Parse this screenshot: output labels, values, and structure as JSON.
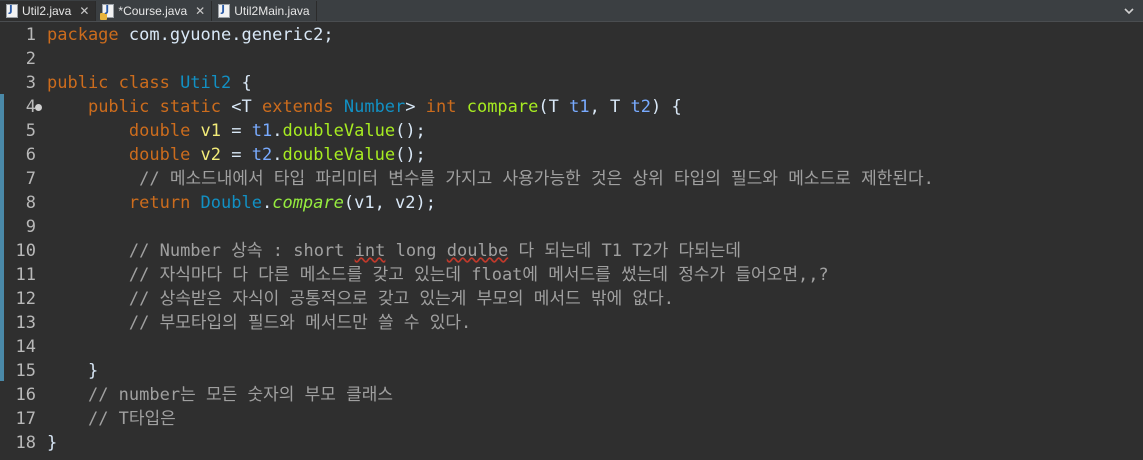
{
  "tabs": [
    {
      "label": "Util2.java",
      "active": true,
      "closable": true,
      "icon": "java-file-icon"
    },
    {
      "label": "*Course.java",
      "active": false,
      "closable": true,
      "icon": "java-file-warning-icon"
    },
    {
      "label": "Util2Main.java",
      "active": false,
      "closable": false,
      "icon": "java-file-icon"
    }
  ],
  "editor": {
    "lines": [
      {
        "n": "1",
        "tokens": [
          [
            "kw",
            "package"
          ],
          [
            "t",
            " com.gyuone.generic2;"
          ]
        ]
      },
      {
        "n": "2",
        "tokens": []
      },
      {
        "n": "3",
        "tokens": [
          [
            "kw",
            "public class "
          ],
          [
            "type",
            "Util2"
          ],
          [
            "t",
            " {"
          ]
        ]
      },
      {
        "n": "4",
        "fold": true,
        "tokens": [
          [
            "t",
            "    "
          ],
          [
            "kw",
            "public static "
          ],
          [
            "t",
            "<T "
          ],
          [
            "kw",
            "extends "
          ],
          [
            "type",
            "Number"
          ],
          [
            "t",
            "> "
          ],
          [
            "kw",
            "int "
          ],
          [
            "meth",
            "compare"
          ],
          [
            "t",
            "(T "
          ],
          [
            "param",
            "t1"
          ],
          [
            "t",
            ", T "
          ],
          [
            "param",
            "t2"
          ],
          [
            "t",
            ") {"
          ]
        ]
      },
      {
        "n": "5",
        "tokens": [
          [
            "t",
            "        "
          ],
          [
            "kw",
            "double "
          ],
          [
            "var",
            "v1"
          ],
          [
            "t",
            " = "
          ],
          [
            "param",
            "t1"
          ],
          [
            "t",
            "."
          ],
          [
            "meth",
            "doubleValue"
          ],
          [
            "t",
            "();"
          ]
        ]
      },
      {
        "n": "6",
        "tokens": [
          [
            "t",
            "        "
          ],
          [
            "kw",
            "double "
          ],
          [
            "var",
            "v2"
          ],
          [
            "t",
            " = "
          ],
          [
            "param",
            "t2"
          ],
          [
            "t",
            "."
          ],
          [
            "meth",
            "doubleValue"
          ],
          [
            "t",
            "();"
          ]
        ]
      },
      {
        "n": "7",
        "tokens": [
          [
            "t",
            "         "
          ],
          [
            "cm",
            "// 메소드내에서 타입 파리미터 변수를 가지고 사용가능한 것은 상위 타입의 필드와 메소드로 제한된다."
          ]
        ]
      },
      {
        "n": "8",
        "tokens": [
          [
            "t",
            "        "
          ],
          [
            "kw",
            "return "
          ],
          [
            "type",
            "Double"
          ],
          [
            "t",
            "."
          ],
          [
            "smeth",
            "compare"
          ],
          [
            "t",
            "(v1, v2);"
          ]
        ]
      },
      {
        "n": "9",
        "tokens": []
      },
      {
        "n": "10",
        "tokens": [
          [
            "t",
            "        "
          ],
          [
            "cm",
            "// Number 상속 : short "
          ],
          [
            "cmul",
            "int"
          ],
          [
            "cm",
            " long "
          ],
          [
            "cmul",
            "doulbe"
          ],
          [
            "cm",
            " 다 되는데 T1 T2가 다되는데"
          ]
        ]
      },
      {
        "n": "11",
        "tokens": [
          [
            "t",
            "        "
          ],
          [
            "cm",
            "// 자식마다 다 다른 메소드를 갖고 있는데 float에 메서드를 썼는데 정수가 들어오면,,?"
          ]
        ]
      },
      {
        "n": "12",
        "tokens": [
          [
            "t",
            "        "
          ],
          [
            "cm",
            "// 상속받은 자식이 공통적으로 갖고 있는게 부모의 메서드 밖에 없다."
          ]
        ]
      },
      {
        "n": "13",
        "tokens": [
          [
            "t",
            "        "
          ],
          [
            "cm",
            "// 부모타입의 필드와 메서드만 쓸 수 있다."
          ]
        ]
      },
      {
        "n": "14",
        "tokens": []
      },
      {
        "n": "15",
        "tokens": [
          [
            "t",
            "    }"
          ]
        ]
      },
      {
        "n": "16",
        "tokens": [
          [
            "t",
            "    "
          ],
          [
            "cm",
            "// number는 모든 숫자의 부모 클래스"
          ]
        ]
      },
      {
        "n": "17",
        "tokens": [
          [
            "t",
            "    "
          ],
          [
            "cm",
            "// T타입은"
          ]
        ]
      },
      {
        "n": "18",
        "tokens": [
          [
            "t",
            "}"
          ]
        ]
      }
    ]
  },
  "colors": {
    "background": "#2f2f2f",
    "keyword": "#cc6c1d",
    "type": "#1290c3",
    "local_variable": "#f3ec79",
    "parameter": "#79abff",
    "method": "#a7ec21",
    "comment": "#a0a0a0",
    "text": "#d9e8f7"
  }
}
